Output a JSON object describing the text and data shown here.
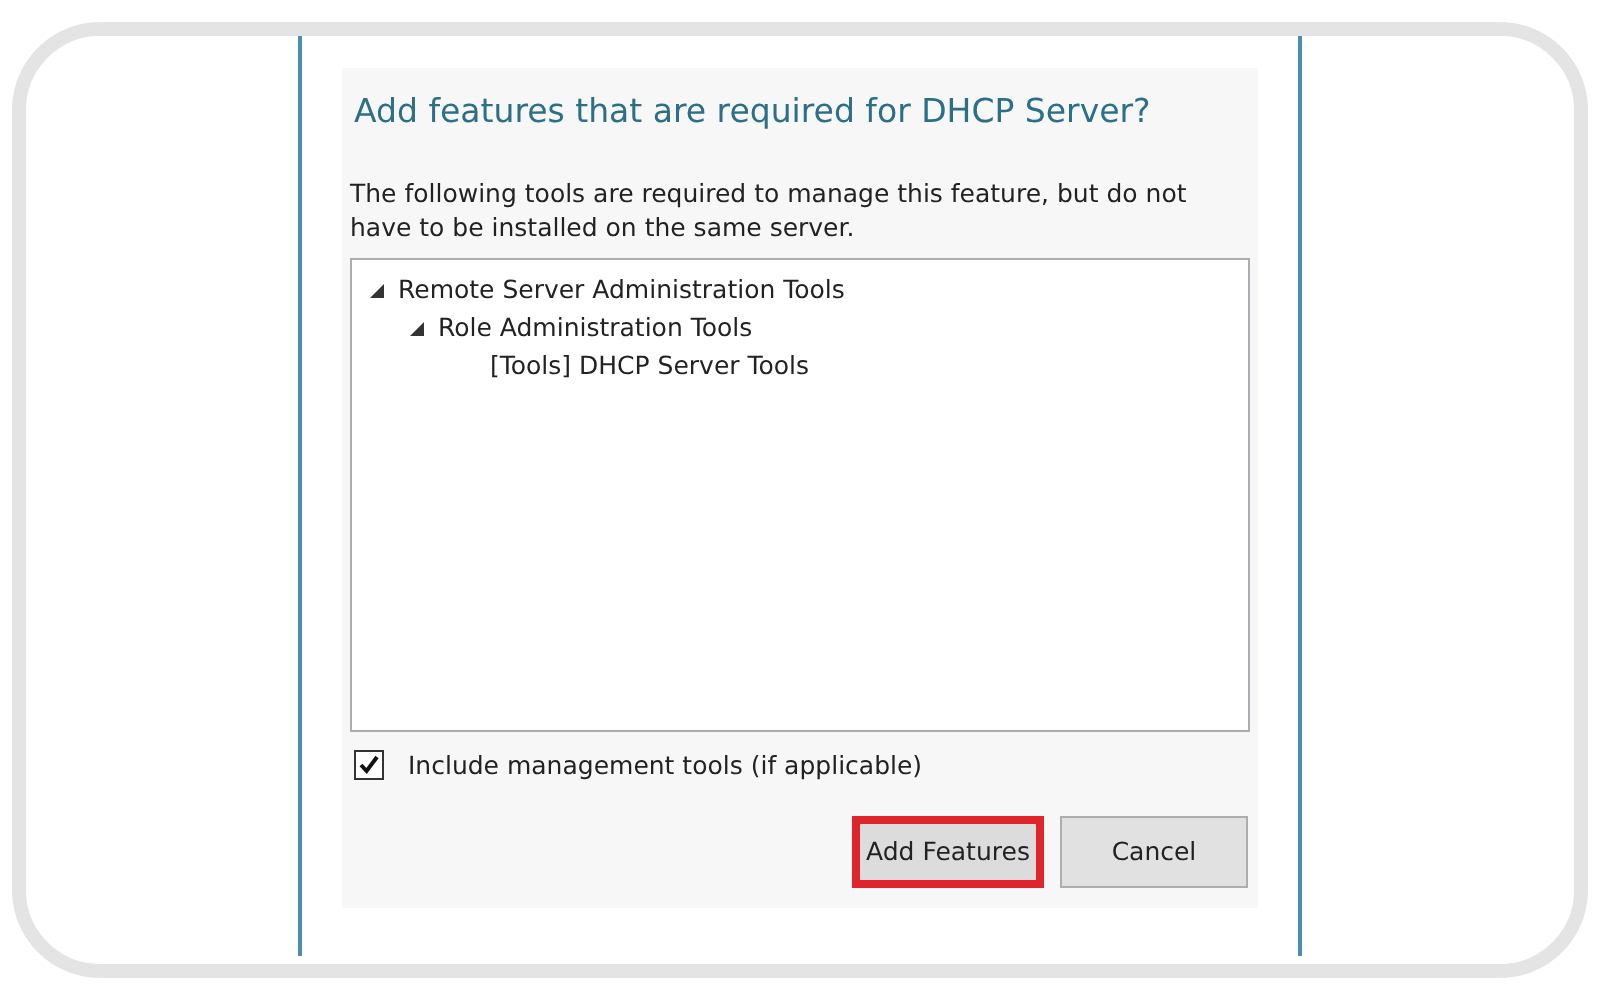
{
  "dialog": {
    "title": "Add features that are required for DHCP Server?",
    "description": "The following tools are required to manage this feature, but do not have to be installed on the same server.",
    "tree": [
      {
        "label": "Remote Server Administration Tools",
        "expanded": true,
        "children": [
          {
            "label": "Role Administration Tools",
            "expanded": true,
            "children": [
              {
                "label": "[Tools] DHCP Server Tools"
              }
            ]
          }
        ]
      }
    ],
    "checkbox": {
      "label": "Include management tools (if applicable)",
      "checked": true
    },
    "buttons": [
      {
        "label": "Add Features",
        "highlighted": true
      },
      {
        "label": "Cancel",
        "highlighted": false
      }
    ]
  }
}
